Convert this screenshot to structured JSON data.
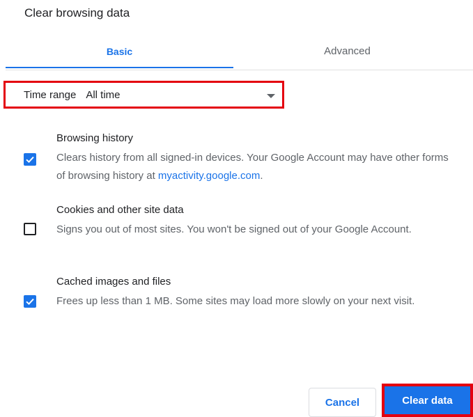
{
  "dialog": {
    "title": "Clear browsing data"
  },
  "tabs": [
    {
      "label": "Basic",
      "selected": true
    },
    {
      "label": "Advanced",
      "selected": false
    }
  ],
  "time_range": {
    "label": "Time range",
    "value": "All time"
  },
  "items": [
    {
      "title": "Browsing history",
      "description": "Clears history from all signed-in devices. Your Google Account may have other forms of browsing history at ",
      "link": "myactivity.google.com",
      "description_end": ".",
      "checked": true
    },
    {
      "title": "Cookies and other site data",
      "description": "Signs you out of most sites. You won't be signed out of your Google Account.",
      "checked": false
    },
    {
      "title": "Cached images and files",
      "description": "Frees up less than 1 MB. Some sites may load more slowly on your next visit.",
      "checked": true
    }
  ],
  "buttons": {
    "cancel": "Cancel",
    "clear": "Clear data"
  },
  "colors": {
    "accent": "#1a73e8",
    "highlight": "#e4000f",
    "text": "#202124",
    "secondary": "#5f6368"
  }
}
